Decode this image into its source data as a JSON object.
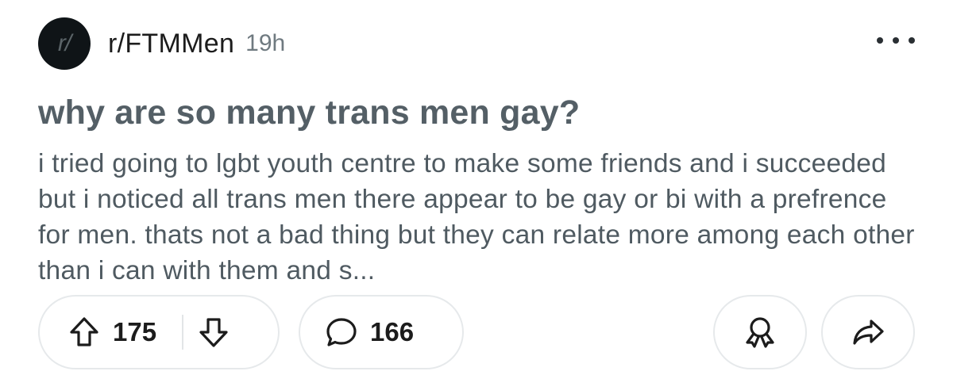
{
  "post": {
    "avatar_text": "r/",
    "subreddit": "r/FTMMen",
    "time": "19h",
    "title": "why are so many trans men gay?",
    "body": "i tried going to lgbt youth centre to make some friends and i succeeded but i noticed all trans men there appear to be gay or bi with a prefrence for men. thats not a bad thing but they can relate more among each other than i can with them and s...",
    "upvotes": "175",
    "comments": "166"
  },
  "icons": {
    "more": "more-options-icon",
    "upvote": "upvote-arrow-icon",
    "downvote": "downvote-arrow-icon",
    "comment": "comment-bubble-icon",
    "award": "award-icon",
    "share": "share-arrow-icon"
  },
  "colors": {
    "title": "#545f66",
    "body": "#4f5a61",
    "avatar_bg": "#0f1417",
    "pill_border": "#e6e9eb"
  }
}
